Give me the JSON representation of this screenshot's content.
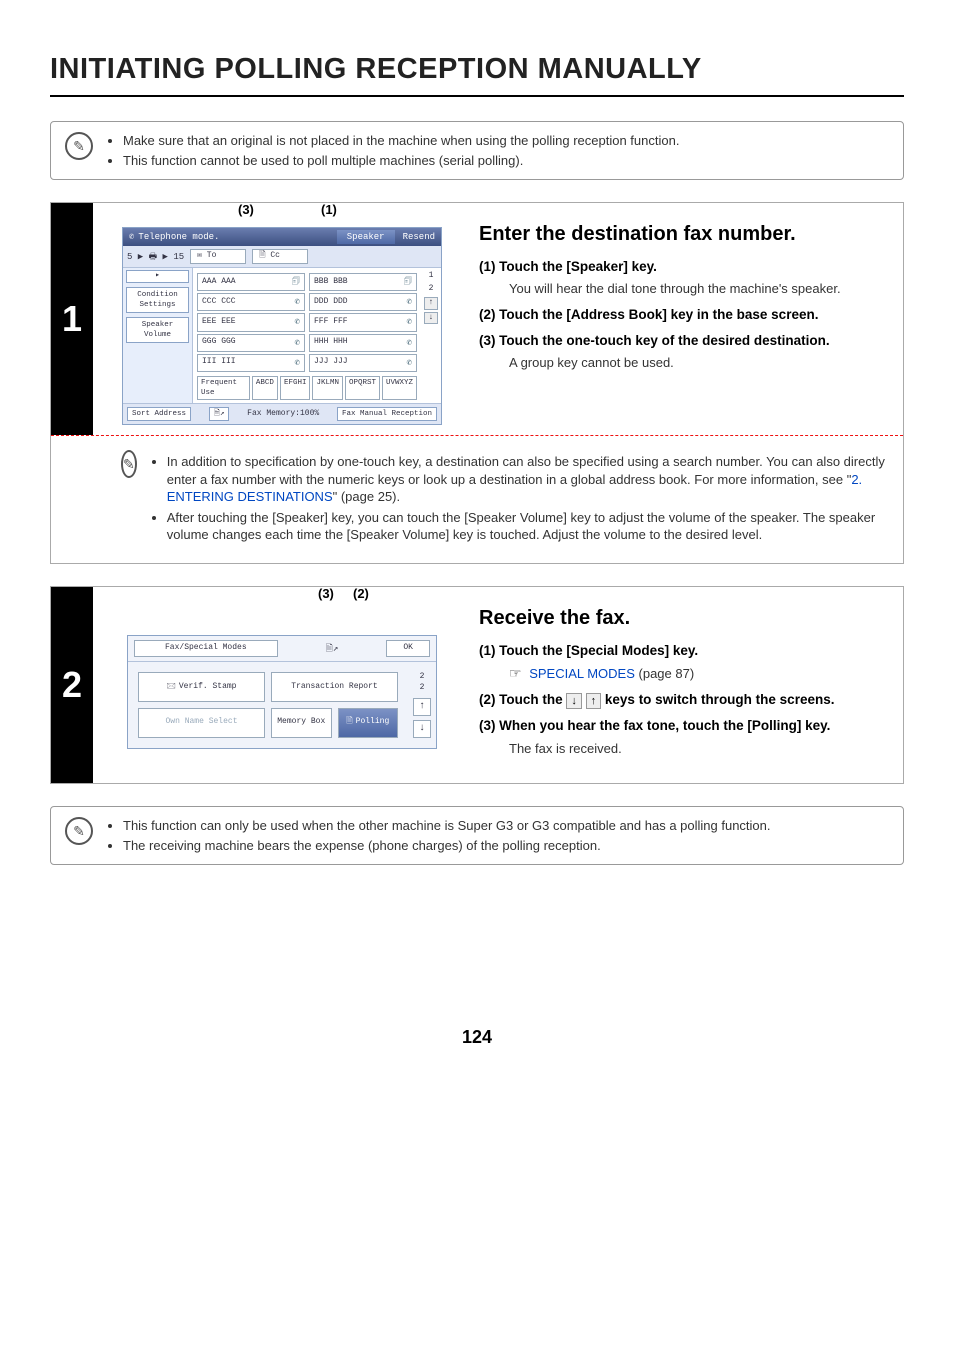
{
  "page_title": "INITIATING POLLING RECEPTION MANUALLY",
  "top_notes": [
    "Make sure that an original is not placed in the machine when using the polling reception function.",
    "This function cannot be used to poll multiple machines (serial polling)."
  ],
  "step1": {
    "number": "1",
    "callouts": {
      "c1": "(1)",
      "c3": "(3)"
    },
    "heading": "Enter the destination fax number.",
    "items": [
      {
        "label": "(1)",
        "title": "Touch the [Speaker] key.",
        "body": "You will hear the dial tone through the machine's speaker."
      },
      {
        "label": "(2)",
        "title": "Touch the [Address Book] key in the base screen.",
        "body": ""
      },
      {
        "label": "(3)",
        "title": "Touch the one-touch key of the desired destination.",
        "body": "A group key cannot be used."
      }
    ],
    "inner_note_parts": {
      "li1_pre": "In addition to specification by one-touch key, a destination can also be specified using a search number. You can also directly enter a fax number with the numeric keys or look up a destination in a global address book. For more information, see \"",
      "li1_link": "2. ENTERING DESTINATIONS",
      "li1_post": "\" (page 25).",
      "li2": "After touching the [Speaker] key, you can touch the [Speaker Volume] key to adjust the volume of the speaker. The speaker volume changes each time the [Speaker Volume] key is touched. Adjust the volume to the desired level."
    },
    "mock": {
      "header": "Telephone mode.",
      "speaker": "Speaker",
      "resend": "Resend",
      "to_label": "To",
      "cc_label": "Cc",
      "side_arrow": "▸",
      "side_btn1": "Condition Settings",
      "side_btn2": "Speaker Volume",
      "rows": [
        [
          "AAA AAA",
          "BBB BBB"
        ],
        [
          "CCC CCC",
          "DDD DDD"
        ],
        [
          "EEE EEE",
          "FFF FFF"
        ],
        [
          "GGG GGG",
          "HHH HHH"
        ],
        [
          "III III",
          "JJJ JJJ"
        ]
      ],
      "page_top": "1",
      "page_bottom": "2",
      "tabs": [
        "Frequent Use",
        "ABCD",
        "EFGHI",
        "JKLMN",
        "OPQRST",
        "UVWXYZ"
      ],
      "sort": "Sort Address",
      "mem": "Fax Memory:100%",
      "manual": "Fax Manual Reception",
      "status": "5 ▶ 🖶 ▶ 15"
    }
  },
  "step2": {
    "number": "2",
    "callouts": {
      "c2": "(2)",
      "c3": "(3)"
    },
    "heading": "Receive the fax.",
    "items": [
      {
        "label": "(1)",
        "title": "Touch the [Special Modes] key.",
        "link_text": "SPECIAL MODES",
        "link_suffix": " (page 87)"
      },
      {
        "label": "(2)",
        "title_pre": "Touch the ",
        "title_post": " keys to switch through the screens.",
        "key1": "↓",
        "key2": "↑"
      },
      {
        "label": "(3)",
        "title": "When you hear the fax tone, touch the [Polling] key.",
        "body": "The fax is received."
      }
    ],
    "mock": {
      "title": "Fax/Special Modes",
      "ok": "OK",
      "buttons": {
        "verif": "Verif. Stamp",
        "trans": "Transaction Report",
        "own": "Own Name Select",
        "mem": "Memory Box",
        "poll": "Polling"
      },
      "page_top": "2",
      "page_bottom": "2"
    }
  },
  "bottom_notes": [
    "This function can only be used when the other machine is Super G3 or G3 compatible and has a polling function.",
    "The receiving machine bears the expense (phone charges) of the polling reception."
  ],
  "page_number": "124"
}
